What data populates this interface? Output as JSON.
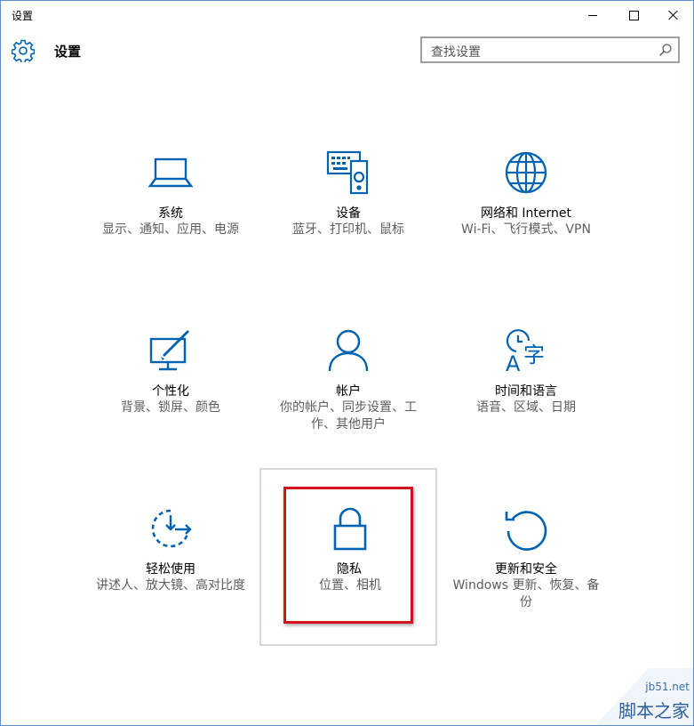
{
  "window": {
    "title": "设置"
  },
  "header": {
    "title": "设置",
    "search_placeholder": "查找设置"
  },
  "tiles": [
    {
      "icon": "laptop-icon",
      "label": "系统",
      "desc": "显示、通知、应用、电源"
    },
    {
      "icon": "devices-icon",
      "label": "设备",
      "desc": "蓝牙、打印机、鼠标"
    },
    {
      "icon": "globe-icon",
      "label": "网络和 Internet",
      "desc": "Wi-Fi、飞行模式、VPN"
    },
    {
      "icon": "personalization-icon",
      "label": "个性化",
      "desc": "背景、锁屏、颜色"
    },
    {
      "icon": "person-icon",
      "label": "帐户",
      "desc": "你的帐户、同步设置、工作、其他用户"
    },
    {
      "icon": "time-language-icon",
      "label": "时间和语言",
      "desc": "语音、区域、日期"
    },
    {
      "icon": "ease-of-access-icon",
      "label": "轻松使用",
      "desc": "讲述人、放大镜、高对比度"
    },
    {
      "icon": "lock-icon",
      "label": "隐私",
      "desc": "位置、相机"
    },
    {
      "icon": "update-icon",
      "label": "更新和安全",
      "desc": "Windows 更新、恢复、备份"
    }
  ],
  "watermark": {
    "url": "jb51.net",
    "name": "脚本之家"
  },
  "colors": {
    "accent": "#0063b1",
    "highlight": "#d3131b",
    "border": "#5b8fc9"
  }
}
